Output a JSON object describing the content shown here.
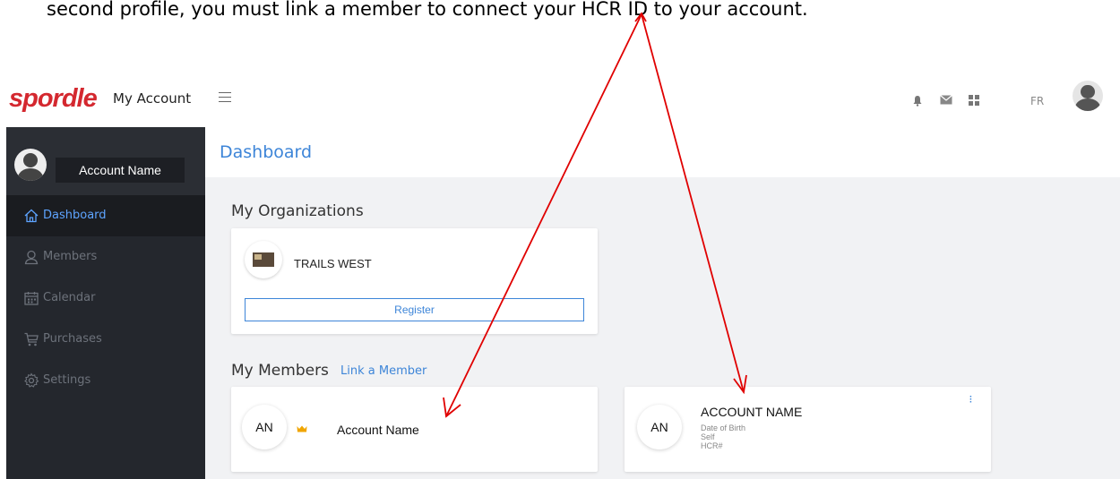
{
  "caption": "second profile, you must link a member to connect your HCR ID to your account.",
  "topbar": {
    "logo": "spordle",
    "logo_sub": "My Account",
    "lang": "FR",
    "icons": [
      "bell-icon",
      "mail-icon",
      "apps-grid-icon",
      "user-avatar-icon"
    ]
  },
  "sidebar": {
    "account_name": "Account Name",
    "items": [
      {
        "label": "Dashboard",
        "icon": "home-icon",
        "active": true
      },
      {
        "label": "Members",
        "icon": "user-icon"
      },
      {
        "label": "Calendar",
        "icon": "calendar-icon"
      },
      {
        "label": "Purchases",
        "icon": "cart-icon"
      },
      {
        "label": "Settings",
        "icon": "gear-icon"
      }
    ]
  },
  "main": {
    "title": "Dashboard",
    "organizations_title": "My Organizations",
    "organization": {
      "name": "TRAILS WEST",
      "register_label": "Register"
    },
    "members_title": "My Members",
    "link_member_label": "Link a Member",
    "members": [
      {
        "initials": "AN",
        "name": "Account Name",
        "crown": true
      },
      {
        "initials": "AN",
        "name": "ACCOUNT NAME",
        "dob_label": "Date of Birth",
        "relation": "Self",
        "hcr_label": "HCR#"
      }
    ]
  },
  "colors": {
    "brand_red": "#d4282f",
    "accent_blue": "#3d85d8",
    "sidebar_bg": "#24272d",
    "annotation_arrow": "#e00000"
  }
}
